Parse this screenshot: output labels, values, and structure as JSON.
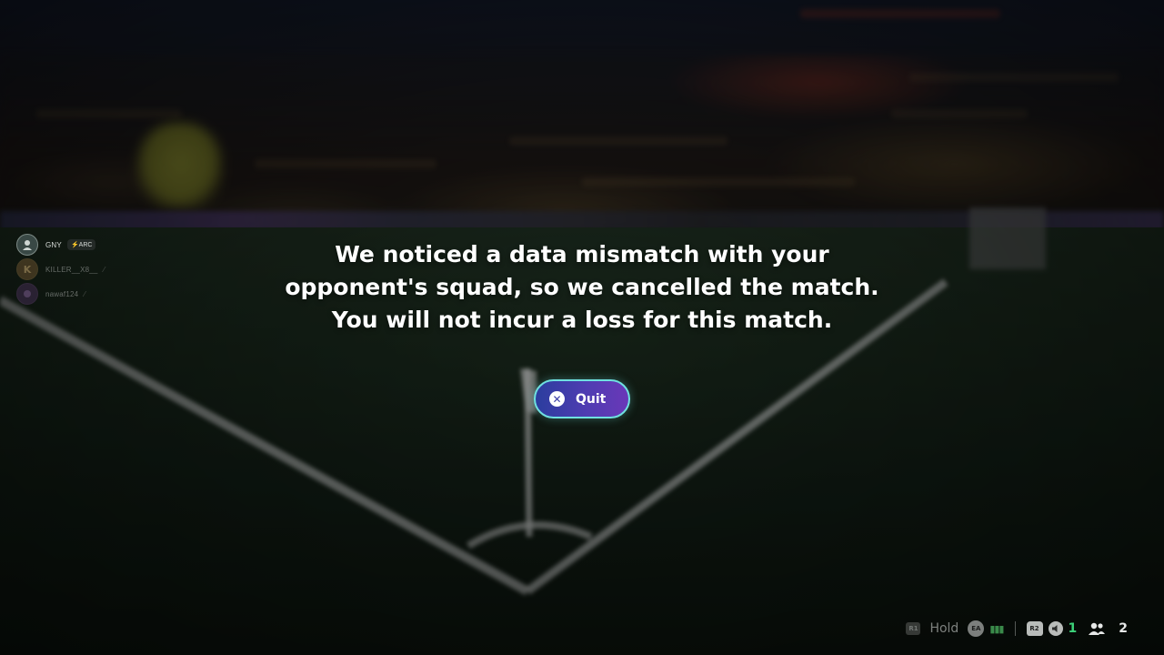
{
  "players": [
    {
      "initial": "",
      "name": "GNY",
      "tag": "⚡ARC",
      "accent": "#7d8a86"
    },
    {
      "initial": "K",
      "name": "KILLER__X8__",
      "tag": "",
      "accent": "#c2a36b"
    },
    {
      "initial": "",
      "name": "nawaf124",
      "tag": "",
      "accent": "#9b7cb0"
    }
  ],
  "message": {
    "line1": "We noticed a data mismatch with your",
    "line2": "opponent's squad, so we cancelled the match.",
    "line3": "You will not incur a loss for this match."
  },
  "quit_button": {
    "label": "Quit",
    "icon": "x-circle-icon",
    "border_color": "#6fe0e0",
    "gradient_start": "#2b3d9e",
    "gradient_end": "#6a38b8"
  },
  "status_bar": {
    "hold_button": "R1",
    "hold_label": "Hold",
    "ea_label": "EA",
    "r2_label": "R2",
    "muted_count": "1",
    "party_count": "2",
    "muted_color": "#3cd27a"
  }
}
